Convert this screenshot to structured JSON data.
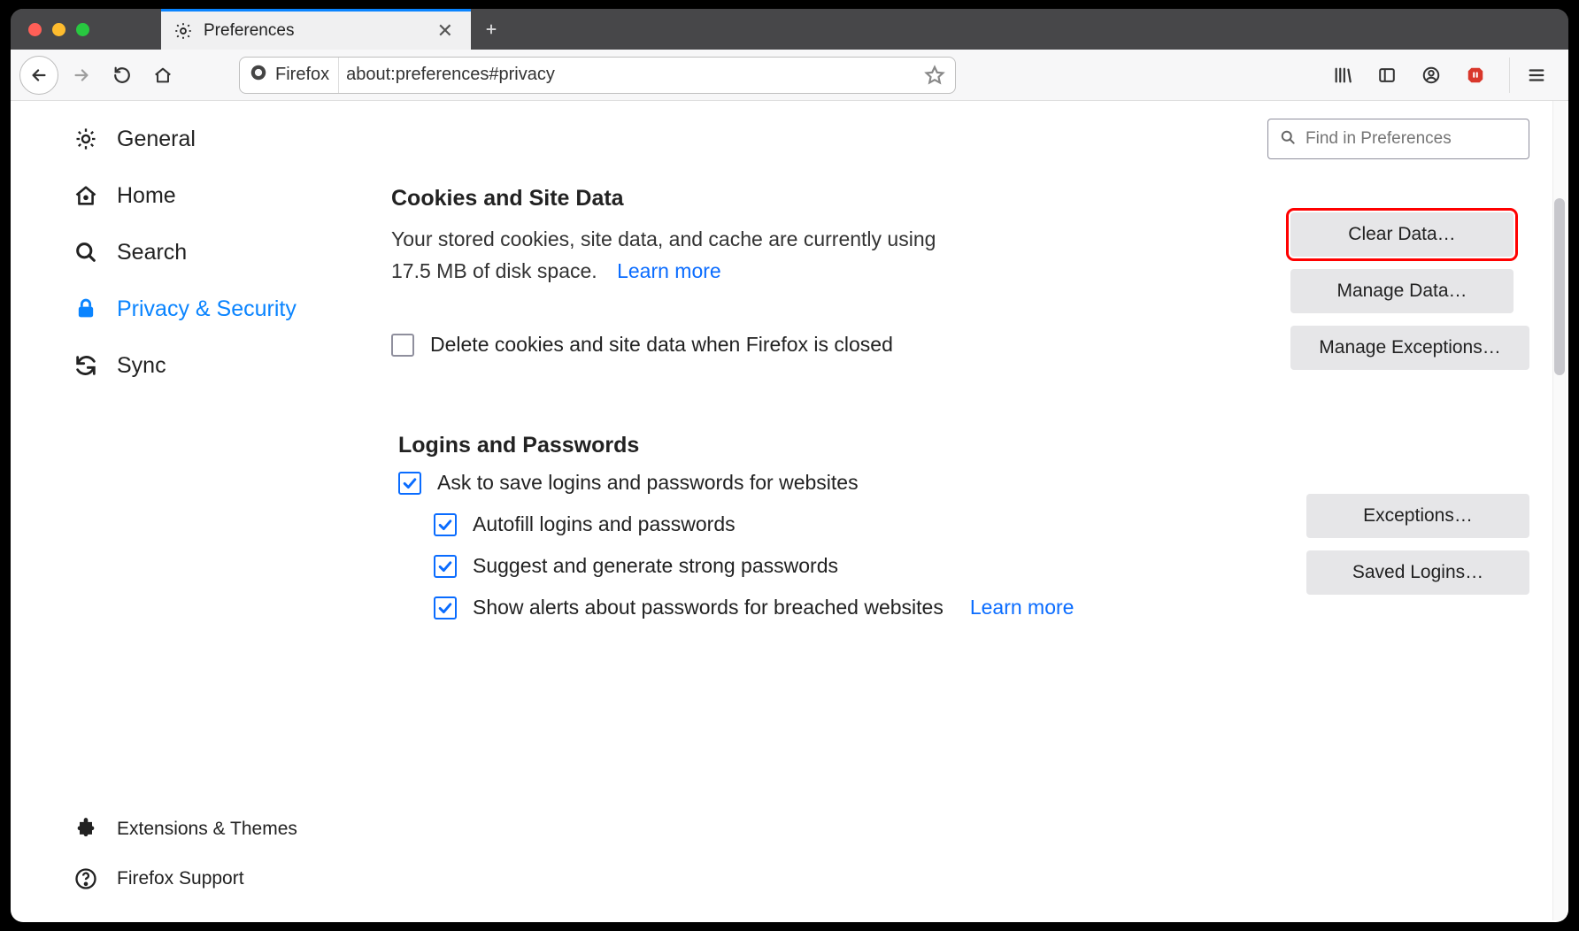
{
  "tab": {
    "title": "Preferences"
  },
  "urlbar": {
    "identity": "Firefox",
    "url": "about:preferences#privacy"
  },
  "search": {
    "placeholder": "Find in Preferences"
  },
  "sidebar": {
    "items": [
      {
        "label": "General"
      },
      {
        "label": "Home"
      },
      {
        "label": "Search"
      },
      {
        "label": "Privacy & Security"
      },
      {
        "label": "Sync"
      }
    ],
    "footer": [
      {
        "label": "Extensions & Themes"
      },
      {
        "label": "Firefox Support"
      }
    ]
  },
  "cookies": {
    "heading": "Cookies and Site Data",
    "desc": "Your stored cookies, site data, and cache are currently using 17.5 MB of disk space.",
    "learn": "Learn more",
    "delete_on_close": "Delete cookies and site data when Firefox is closed",
    "buttons": {
      "clear": "Clear Data…",
      "manage": "Manage Data…",
      "exceptions": "Manage Exceptions…"
    }
  },
  "logins": {
    "heading": "Logins and Passwords",
    "ask": "Ask to save logins and passwords for websites",
    "autofill": "Autofill logins and passwords",
    "suggest": "Suggest and generate strong passwords",
    "alerts": "Show alerts about passwords for breached websites",
    "learn": "Learn more",
    "buttons": {
      "exceptions": "Exceptions…",
      "saved": "Saved Logins…"
    }
  }
}
